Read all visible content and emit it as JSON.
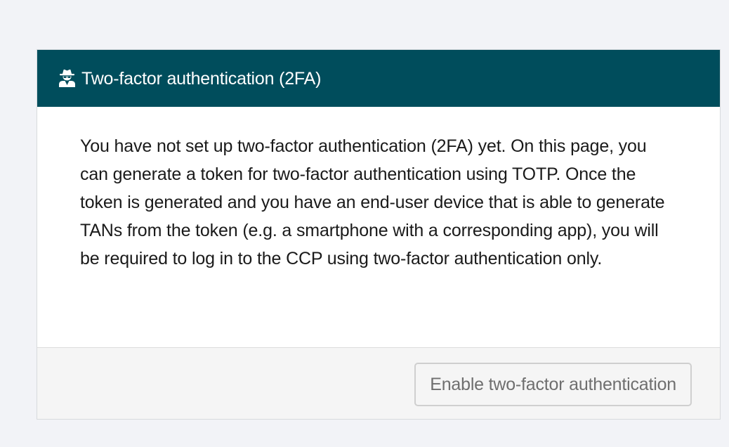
{
  "panel": {
    "header": {
      "icon": "user-secret-icon",
      "title": "Two-factor authentication (2FA)",
      "background_color": "#004d5c"
    },
    "body": {
      "text": "You have not set up two-factor authentication (2FA) yet. On this page, you can generate a token for two-factor authentication using TOTP. Once the token is generated and you have an end-user device that is able to generate TANs from the token (e.g. a smartphone with a corresponding app), you will be required to log in to the CCP using two-factor authentication only."
    },
    "footer": {
      "enable_button_label": "Enable two-factor authentication"
    }
  }
}
